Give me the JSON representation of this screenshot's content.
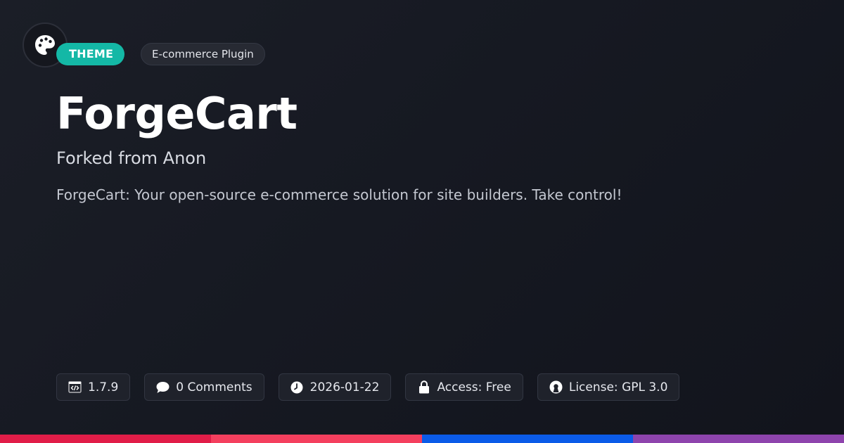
{
  "header": {
    "type_label": "THEME",
    "category_label": "E-commerce Plugin"
  },
  "title": "ForgeCart",
  "subtitle": "Forked from Anon",
  "description": "ForgeCart: Your open-source e-commerce solution for site builders. Take control!",
  "meta": {
    "version": "1.7.9",
    "comments": "0 Comments",
    "date": "2026-01-22",
    "access": "Access: Free",
    "license": "License: GPL 3.0"
  },
  "icons": {
    "logo": "palette-icon",
    "version": "code-icon",
    "comments": "comment-icon",
    "date": "clock-icon",
    "access": "lock-icon",
    "license": "open-source-icon"
  },
  "colors": {
    "type_pill": "#14b8a6",
    "bar": [
      "#e11d48",
      "#f43f5e",
      "#0b5be8",
      "#8e44ad"
    ]
  }
}
